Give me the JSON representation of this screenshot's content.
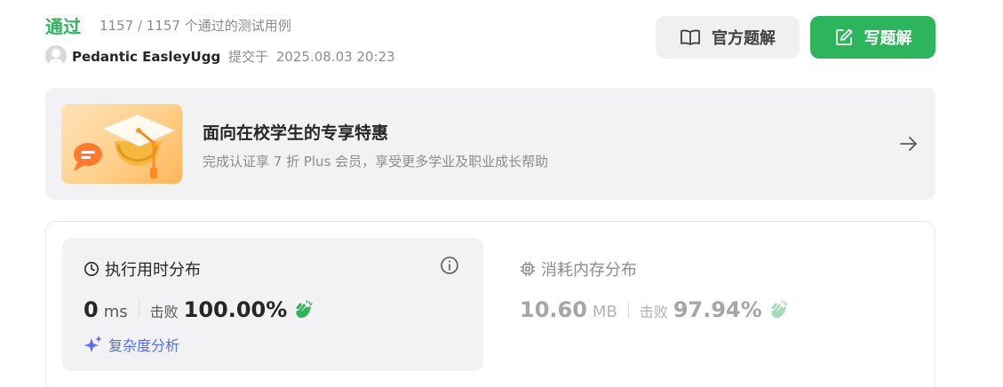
{
  "submission": {
    "status": "通过",
    "tests_passed": "1157 / 1157 个通过的测试用例",
    "username": "Pedantic EasleyUgg",
    "submit_prefix": "提交于",
    "submit_time": "2025.08.03 20:23"
  },
  "buttons": {
    "official_solution": "官方题解",
    "write_solution": "写题解"
  },
  "promo": {
    "title": "面向在校学生的专享特惠",
    "subtitle": "完成认证享 7 折 Plus 会员，享受更多学业及职业成长帮助"
  },
  "runtime": {
    "title": "执行用时分布",
    "value": "0",
    "unit": "ms",
    "beat_label": "击败",
    "percent": "100.00%",
    "complexity_link": "复杂度分析"
  },
  "memory": {
    "title": "消耗内存分布",
    "value": "10.60",
    "unit": "MB",
    "beat_label": "击败",
    "percent": "97.94%"
  },
  "colors": {
    "accent_green": "#2db55d",
    "link_blue": "#4e6ef2",
    "panel_bg": "#f2f2f4"
  },
  "icons": [
    "book-icon",
    "edit-icon",
    "graduation-cap-icon",
    "arrow-right-icon",
    "clock-icon",
    "info-icon",
    "clap-icon",
    "sparkle-icon",
    "chip-icon"
  ]
}
